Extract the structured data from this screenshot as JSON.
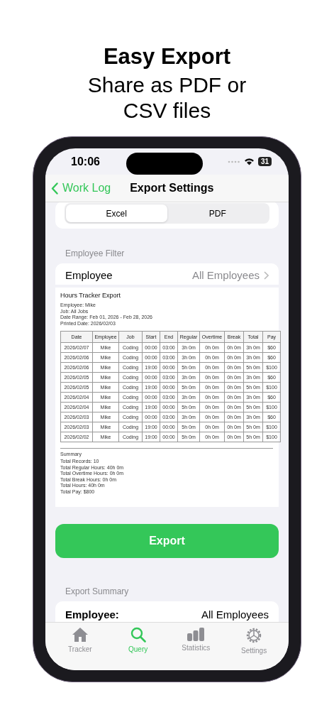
{
  "headline": {
    "title": "Easy Export",
    "subtitle": "Share as PDF or CSV files"
  },
  "status_bar": {
    "time": "10:06",
    "battery": "31"
  },
  "nav": {
    "back": "Work Log",
    "title": "Export Settings"
  },
  "format_tabs": [
    {
      "label": "Excel",
      "selected": true
    },
    {
      "label": "PDF",
      "selected": false
    }
  ],
  "employee_filter": {
    "header": "Employee Filter",
    "label": "Employee",
    "value": "All Employees"
  },
  "pdf_preview": {
    "title": "Hours Tracker Export",
    "meta": [
      "Employee: Mike",
      "Job: All Jobs",
      "Date Range: Feb 01, 2026 - Feb 28, 2026",
      "Printed Date: 2026/02/03"
    ],
    "columns": [
      "Date",
      "Employee",
      "Job",
      "Start",
      "End",
      "Regular",
      "Overtime",
      "Break",
      "Total",
      "Pay"
    ],
    "rows": [
      [
        "2026/02/07",
        "Mike",
        "Coding",
        "00:00",
        "03:00",
        "3h 0m",
        "0h 0m",
        "0h 0m",
        "3h 0m",
        "$60"
      ],
      [
        "2026/02/06",
        "Mike",
        "Coding",
        "00:00",
        "03:00",
        "3h 0m",
        "0h 0m",
        "0h 0m",
        "3h 0m",
        "$60"
      ],
      [
        "2026/02/06",
        "Mike",
        "Coding",
        "19:00",
        "00:00",
        "5h 0m",
        "0h 0m",
        "0h 0m",
        "5h 0m",
        "$100"
      ],
      [
        "2026/02/05",
        "Mike",
        "Coding",
        "00:00",
        "03:00",
        "3h 0m",
        "0h 0m",
        "0h 0m",
        "3h 0m",
        "$60"
      ],
      [
        "2026/02/05",
        "Mike",
        "Coding",
        "19:00",
        "00:00",
        "5h 0m",
        "0h 0m",
        "0h 0m",
        "5h 0m",
        "$100"
      ],
      [
        "2026/02/04",
        "Mike",
        "Coding",
        "00:00",
        "03:00",
        "3h 0m",
        "0h 0m",
        "0h 0m",
        "3h 0m",
        "$60"
      ],
      [
        "2026/02/04",
        "Mike",
        "Coding",
        "19:00",
        "00:00",
        "5h 0m",
        "0h 0m",
        "0h 0m",
        "5h 0m",
        "$100"
      ],
      [
        "2026/02/03",
        "Mike",
        "Coding",
        "00:00",
        "03:00",
        "3h 0m",
        "0h 0m",
        "0h 0m",
        "3h 0m",
        "$60"
      ],
      [
        "2026/02/03",
        "Mike",
        "Coding",
        "19:00",
        "00:00",
        "5h 0m",
        "0h 0m",
        "0h 0m",
        "5h 0m",
        "$100"
      ],
      [
        "2026/02/02",
        "Mike",
        "Coding",
        "19:00",
        "00:00",
        "5h 0m",
        "0h 0m",
        "0h 0m",
        "5h 0m",
        "$100"
      ]
    ],
    "summary_title": "Summary",
    "summary": [
      "Total Records: 10",
      "Total Regular Hours: 40h 0m",
      "Total Overtime Hours: 0h 0m",
      "Total Break Hours: 0h 0m",
      "Total Hours: 40h 0m",
      "Total Pay: $800"
    ]
  },
  "export_button": "Export",
  "export_summary": {
    "header": "Export Summary",
    "rows": [
      {
        "label": "Employee:",
        "value": "All Employees"
      }
    ]
  },
  "tab_bar": [
    {
      "label": "Tracker",
      "kind": "house",
      "selected": false
    },
    {
      "label": "Query",
      "kind": "search",
      "selected": true
    },
    {
      "label": "Statistics",
      "kind": "bars",
      "selected": false
    },
    {
      "label": "Settings",
      "kind": "gear",
      "selected": false
    }
  ]
}
